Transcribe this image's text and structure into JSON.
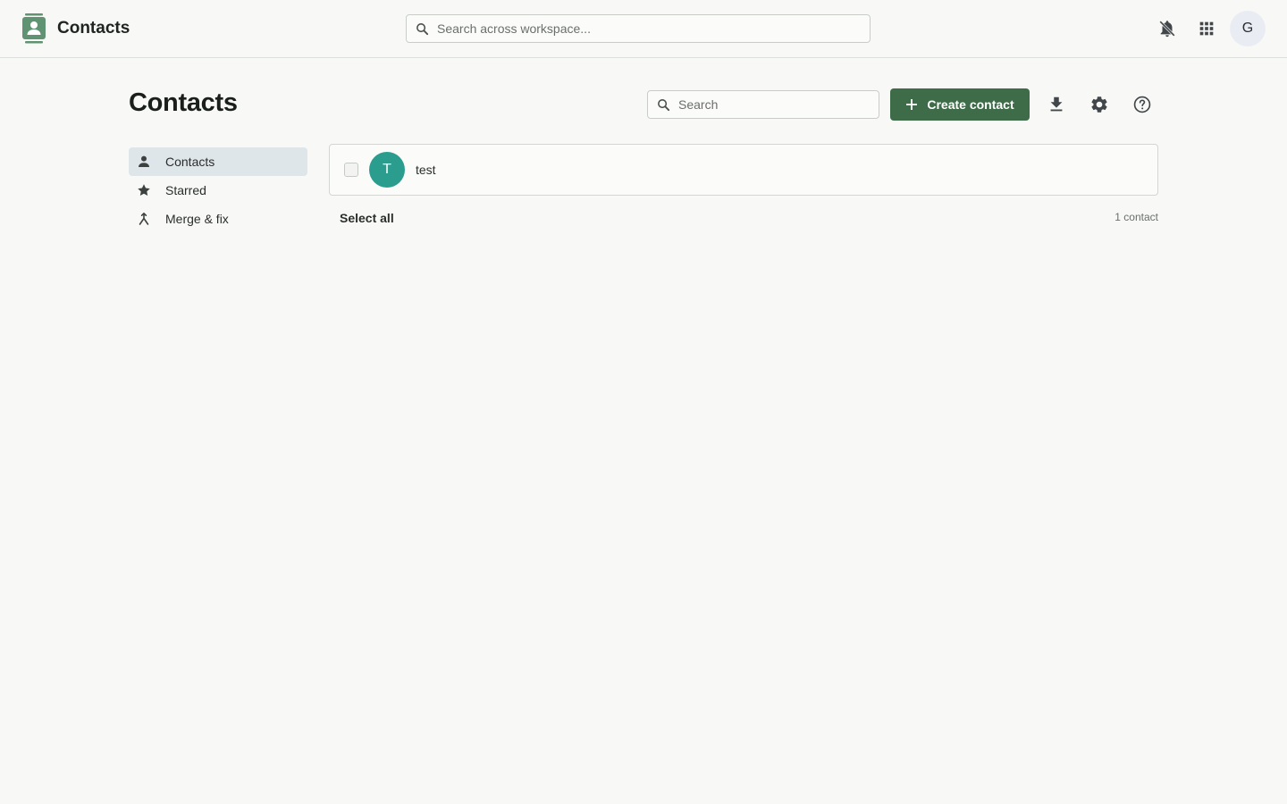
{
  "app": {
    "title": "Contacts",
    "accent_color": "#3e6b48",
    "logo_icon": "contacts-book-icon"
  },
  "global_search": {
    "placeholder": "Search across workspace...",
    "value": ""
  },
  "topbar_actions": {
    "notifications_icon": "bell-off-icon",
    "apps_icon": "grid-apps-icon",
    "avatar_initial": "G"
  },
  "page": {
    "title": "Contacts",
    "search_placeholder": "Search",
    "search_value": "",
    "create_label": "Create contact",
    "download_icon": "download-icon",
    "settings_icon": "gear-icon",
    "help_icon": "help-circle-icon"
  },
  "sidebar": {
    "items": [
      {
        "label": "Contacts",
        "icon": "person-icon",
        "active": true
      },
      {
        "label": "Starred",
        "icon": "star-icon",
        "active": false
      },
      {
        "label": "Merge & fix",
        "icon": "merge-icon",
        "active": false
      }
    ]
  },
  "contacts": {
    "rows": [
      {
        "initial": "T",
        "name": "test",
        "avatar_color": "#2a9d8f",
        "checked": false
      }
    ],
    "select_all_label": "Select all",
    "count_label": "1 contact"
  }
}
